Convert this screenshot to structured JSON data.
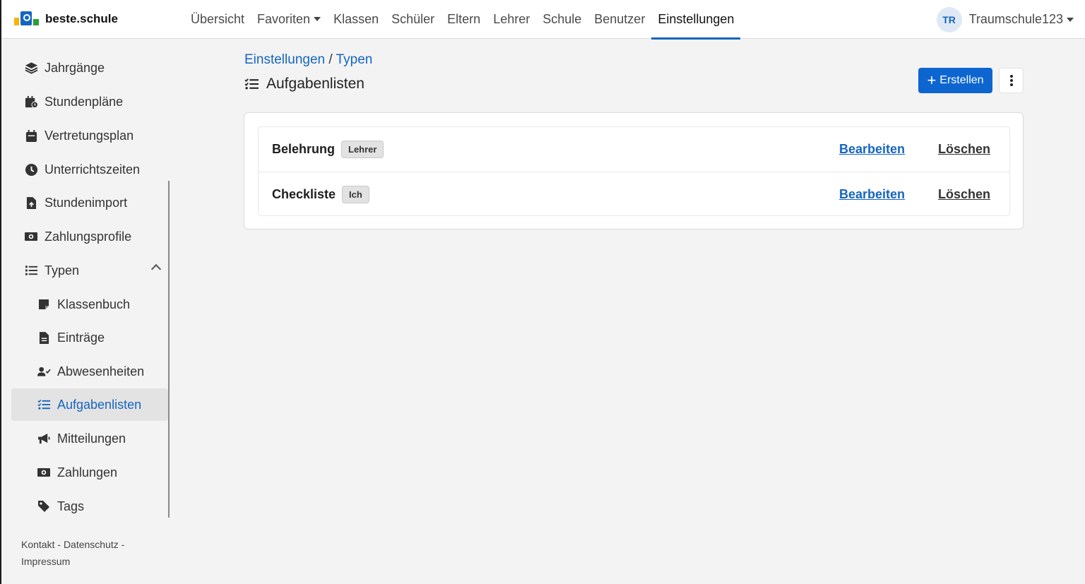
{
  "brand": {
    "name": "beste.schule",
    "logo_colors": [
      "#f6b400",
      "#1565c0",
      "#2e9d3a"
    ]
  },
  "nav": {
    "items": [
      {
        "label": "Übersicht"
      },
      {
        "label": "Favoriten"
      },
      {
        "label": "Klassen"
      },
      {
        "label": "Schüler"
      },
      {
        "label": "Eltern"
      },
      {
        "label": "Lehrer"
      },
      {
        "label": "Schule"
      },
      {
        "label": "Benutzer"
      },
      {
        "label": "Einstellungen"
      }
    ],
    "active": "Einstellungen"
  },
  "user": {
    "initials": "TR",
    "name": "Traumschule123"
  },
  "sidebar": {
    "items": [
      {
        "label": "Jahrgänge",
        "icon": "layers-icon"
      },
      {
        "label": "Stundenpläne",
        "icon": "calendar-clock-icon"
      },
      {
        "label": "Vertretungsplan",
        "icon": "calendar-icon"
      },
      {
        "label": "Unterrichtszeiten",
        "icon": "clock-icon"
      },
      {
        "label": "Stundenimport",
        "icon": "file-upload-icon"
      },
      {
        "label": "Zahlungsprofile",
        "icon": "money-icon"
      },
      {
        "label": "Typen",
        "icon": "list-icon",
        "expanded": true
      },
      {
        "label": "Klassenbuch",
        "icon": "note-icon"
      },
      {
        "label": "Einträge",
        "icon": "file-text-icon"
      },
      {
        "label": "Abwesenheiten",
        "icon": "user-check-icon"
      },
      {
        "label": "Aufgabenlisten",
        "icon": "checklist-icon",
        "active": true
      },
      {
        "label": "Mitteilungen",
        "icon": "megaphone-icon"
      },
      {
        "label": "Zahlungen",
        "icon": "money-icon"
      },
      {
        "label": "Tags",
        "icon": "tag-icon"
      }
    ],
    "footer": {
      "kontakt": "Kontakt",
      "datenschutz": "Datenschutz",
      "impressum": "Impressum",
      "separator": "-"
    }
  },
  "breadcrumb": {
    "parent": "Einstellungen",
    "separator": "/",
    "current": "Typen"
  },
  "page": {
    "title": "Aufgabenlisten",
    "title_icon": "checklist-icon"
  },
  "actions": {
    "create_label": "Erstellen",
    "more_icon": "kebab-icon"
  },
  "list": {
    "rows": [
      {
        "title": "Belehrung",
        "badge": "Lehrer",
        "edit": "Bearbeiten",
        "delete": "Löschen"
      },
      {
        "title": "Checkliste",
        "badge": "Ich",
        "edit": "Bearbeiten",
        "delete": "Löschen"
      }
    ]
  },
  "colors": {
    "accent": "#1565c0",
    "button": "#0d66d0",
    "background": "#f3f3f3"
  }
}
